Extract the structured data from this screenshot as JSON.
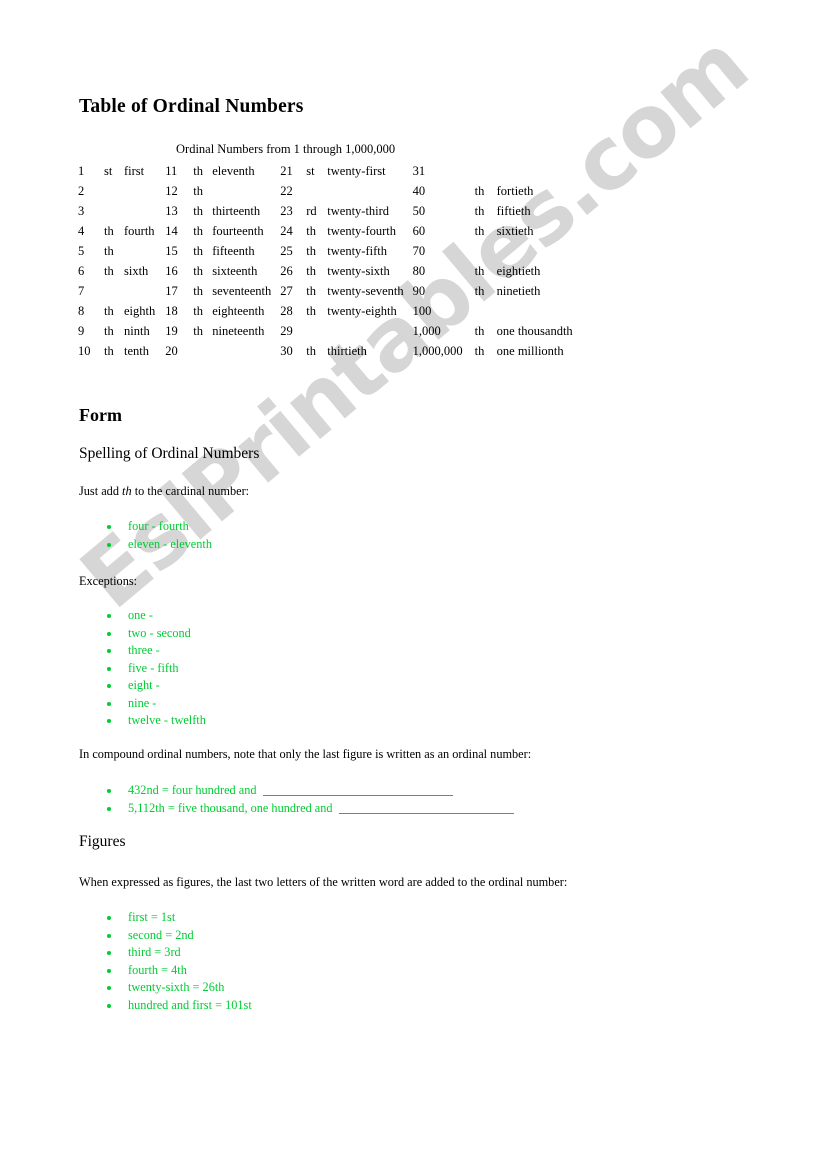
{
  "document": {
    "title": "Table of Ordinal Numbers",
    "watermark": "EslPrintables.com",
    "watermark_color": "#d6d6d6",
    "accent_color": "#00CC33",
    "text_color": "#000000"
  },
  "table_section": {
    "heading": "Table of Ordinal Numbers",
    "caption": "Ordinal Numbers from 1 through 1,000,000",
    "rows": [
      {
        "g0": {
          "num": "1",
          "suffix": "st",
          "word": "first"
        },
        "g1": {
          "num": "11",
          "suffix": "th",
          "word": "eleventh"
        },
        "g2": {
          "num": "21",
          "suffix": "st",
          "word": "twenty-first"
        },
        "g3": {
          "num": "31",
          "suffix": "",
          "word": ""
        }
      },
      {
        "g0": {
          "num": "2",
          "suffix": "",
          "word": ""
        },
        "g1": {
          "num": "12",
          "suffix": "th",
          "word": ""
        },
        "g2": {
          "num": "22",
          "suffix": "",
          "word": ""
        },
        "g3": {
          "num": "40",
          "suffix": "th",
          "word": "fortieth"
        }
      },
      {
        "g0": {
          "num": "3",
          "suffix": "",
          "word": ""
        },
        "g1": {
          "num": "13",
          "suffix": "th",
          "word": "thirteenth"
        },
        "g2": {
          "num": "23",
          "suffix": "rd",
          "word": "twenty-third"
        },
        "g3": {
          "num": "50",
          "suffix": "th",
          "word": "fiftieth"
        }
      },
      {
        "g0": {
          "num": "4",
          "suffix": "th",
          "word": "fourth"
        },
        "g1": {
          "num": "14",
          "suffix": "th",
          "word": "fourteenth"
        },
        "g2": {
          "num": "24",
          "suffix": "th",
          "word": "twenty-fourth"
        },
        "g3": {
          "num": "60",
          "suffix": "th",
          "word": "sixtieth"
        }
      },
      {
        "g0": {
          "num": "5",
          "suffix": "th",
          "word": ""
        },
        "g1": {
          "num": "15",
          "suffix": "th",
          "word": "fifteenth"
        },
        "g2": {
          "num": "25",
          "suffix": "th",
          "word": "twenty-fifth"
        },
        "g3": {
          "num": "70",
          "suffix": "",
          "word": ""
        }
      },
      {
        "g0": {
          "num": "6",
          "suffix": "th",
          "word": "sixth"
        },
        "g1": {
          "num": "16",
          "suffix": "th",
          "word": "sixteenth"
        },
        "g2": {
          "num": "26",
          "suffix": "th",
          "word": "twenty-sixth"
        },
        "g3": {
          "num": "80",
          "suffix": "th",
          "word": "eightieth"
        }
      },
      {
        "g0": {
          "num": "7",
          "suffix": "",
          "word": ""
        },
        "g1": {
          "num": "17",
          "suffix": "th",
          "word": "seventeenth"
        },
        "g2": {
          "num": "27",
          "suffix": "th",
          "word": "twenty-seventh"
        },
        "g3": {
          "num": "90",
          "suffix": "th",
          "word": "ninetieth"
        }
      },
      {
        "g0": {
          "num": "8",
          "suffix": "th",
          "word": "eighth"
        },
        "g1": {
          "num": "18",
          "suffix": "th",
          "word": "eighteenth"
        },
        "g2": {
          "num": "28",
          "suffix": "th",
          "word": "twenty-eighth"
        },
        "g3": {
          "num": "100",
          "suffix": "",
          "word": ""
        }
      },
      {
        "g0": {
          "num": "9",
          "suffix": "th",
          "word": "ninth"
        },
        "g1": {
          "num": "19",
          "suffix": "th",
          "word": "nineteenth"
        },
        "g2": {
          "num": "29",
          "suffix": "",
          "word": ""
        },
        "g3": {
          "num": "1,000",
          "suffix": "th",
          "word": "one thousandth"
        }
      },
      {
        "g0": {
          "num": "10",
          "suffix": "th",
          "word": "tenth"
        },
        "g1": {
          "num": "20",
          "suffix": "",
          "word": ""
        },
        "g2": {
          "num": "30",
          "suffix": "th",
          "word": "thirtieth"
        },
        "g3": {
          "num": "1,000,000",
          "suffix": "th",
          "word": "one millionth"
        }
      }
    ]
  },
  "form_section": {
    "heading": "Form",
    "subheading": "Spelling of Ordinal Numbers",
    "rule_text_before": "Just add ",
    "rule_text_italic": "th",
    "rule_text_after": " to the cardinal number:",
    "rule_examples": [
      "four - fourth",
      "eleven - eleventh"
    ],
    "exceptions_label": "Exceptions:",
    "exceptions": [
      "one -",
      "two - second",
      "three -",
      "five - fifth",
      "eight -",
      "nine -",
      "twelve - twelfth"
    ],
    "compound_text": "In compound ordinal numbers, note that only the last figure is written as an ordinal number:",
    "compound_examples": [
      {
        "text": "432nd  = four hundred and",
        "blank": true
      },
      {
        "text": "5,112th = five thousand, one hundred and",
        "blank": true
      }
    ]
  },
  "figures_section": {
    "heading": "Figures",
    "intro": "When expressed as figures, the last two letters of the written word are added to the ordinal number:",
    "examples": [
      "first = 1st",
      "second = 2nd",
      "third = 3rd",
      "fourth = 4th",
      "twenty-sixth = 26th",
      "hundred and first = 101st"
    ]
  }
}
